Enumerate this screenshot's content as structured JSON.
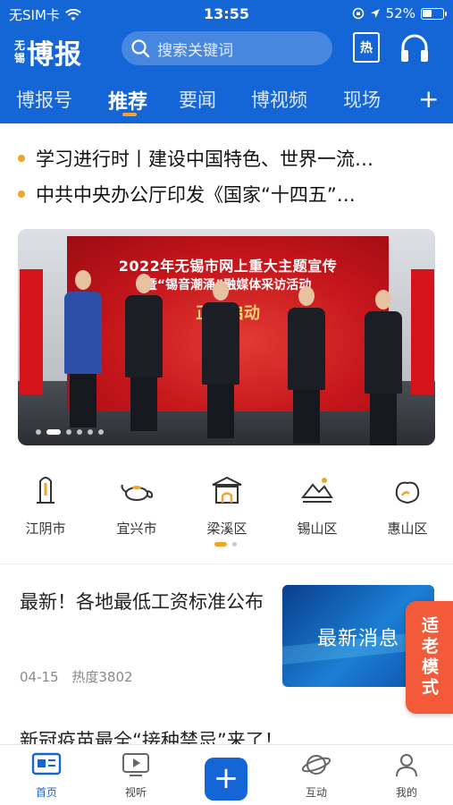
{
  "status_bar": {
    "carrier": "无SIM卡",
    "time": "13:55",
    "battery": "52%",
    "battery_level": 0.52
  },
  "header": {
    "logo_small_1": "无",
    "logo_small_2": "锡",
    "logo_big": "博报",
    "search_placeholder": "搜索关键词",
    "hot_label": "热"
  },
  "tabs": [
    "博报号",
    "推荐",
    "要闻",
    "博视频",
    "现场"
  ],
  "active_tab": 1,
  "headlines": [
    "学习进行时丨建设中国特色、世界一流…",
    "中共中央办公厅印发《国家“十四五”…"
  ],
  "banner": {
    "line1": "2022年无锡市网上重大主题宣传",
    "line2": "暨“锡音潮涌”融媒体采访活动",
    "line3": "正式启动",
    "slides": 6,
    "current_slide": 1
  },
  "districts": [
    {
      "label": "江阴市",
      "icon": "tower-icon"
    },
    {
      "label": "宜兴市",
      "icon": "teapot-icon"
    },
    {
      "label": "梁溪区",
      "icon": "gate-icon"
    },
    {
      "label": "锡山区",
      "icon": "mountain-icon"
    },
    {
      "label": "惠山区",
      "icon": "peach-icon"
    }
  ],
  "article": {
    "title": "最新！各地最低工资标准公布",
    "date": "04-15",
    "heat": "热度3802",
    "thumb_text": "最新消息"
  },
  "elder_mode": "适老模式",
  "article2_title": "新冠疫苗最全“接种禁忌”来了！",
  "bottom_nav": {
    "home": "首页",
    "video": "视听",
    "interact": "互动",
    "mine": "我的",
    "plus": "+"
  },
  "colors": {
    "brand_blue": "#1466d6",
    "accent_orange": "#f0a52a",
    "elder_red": "#f35a3a"
  }
}
